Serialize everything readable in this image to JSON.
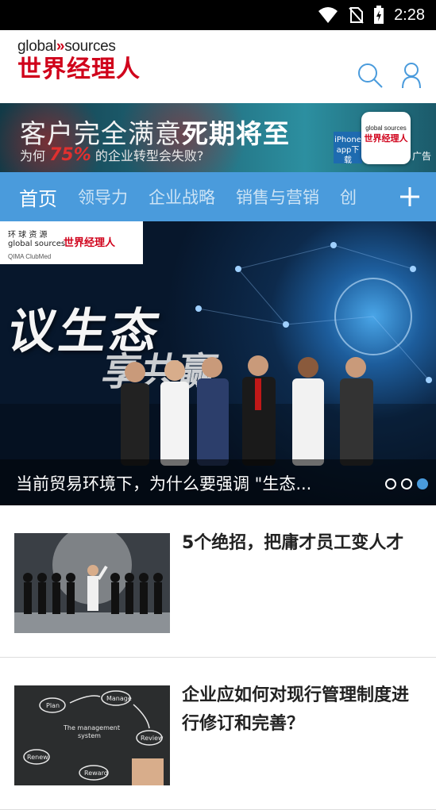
{
  "status_bar": {
    "time": "2:28"
  },
  "header": {
    "logo_en": "global",
    "logo_en2": "sources",
    "logo_cn": "世界经理人"
  },
  "ad": {
    "headline_part1": "客户完全满意",
    "headline_part2": "死期将至",
    "subline_pre": "为何",
    "subline_pct": "75%",
    "subline_post": "的企业转型会失败?",
    "iphone_label": "iPhone app下载",
    "app_en": "global sources",
    "app_cn": "世界经理人",
    "tag": "广告"
  },
  "nav": {
    "tabs": [
      "首页",
      "领导力",
      "企业战略",
      "销售与营销",
      "创"
    ]
  },
  "banner": {
    "strip_line1": "环 球 资 源",
    "strip_line2": "global sources",
    "strip_cn": "世界经理人",
    "strip_sponsors": "QIMA   ClubMed",
    "calligraphy1": "议生态",
    "calligraphy2": "享共赢",
    "caption": "当前贸易环境下，为什么要强调 \"生态...",
    "page_count": 3,
    "active_page": 3
  },
  "articles": [
    {
      "title": "5个绝招，把庸才员工变人才"
    },
    {
      "title": "企业应如何对现行管理制度进行修订和完善？"
    }
  ],
  "colors": {
    "nav": "#4a9bdc",
    "brand_red": "#d0021b"
  }
}
